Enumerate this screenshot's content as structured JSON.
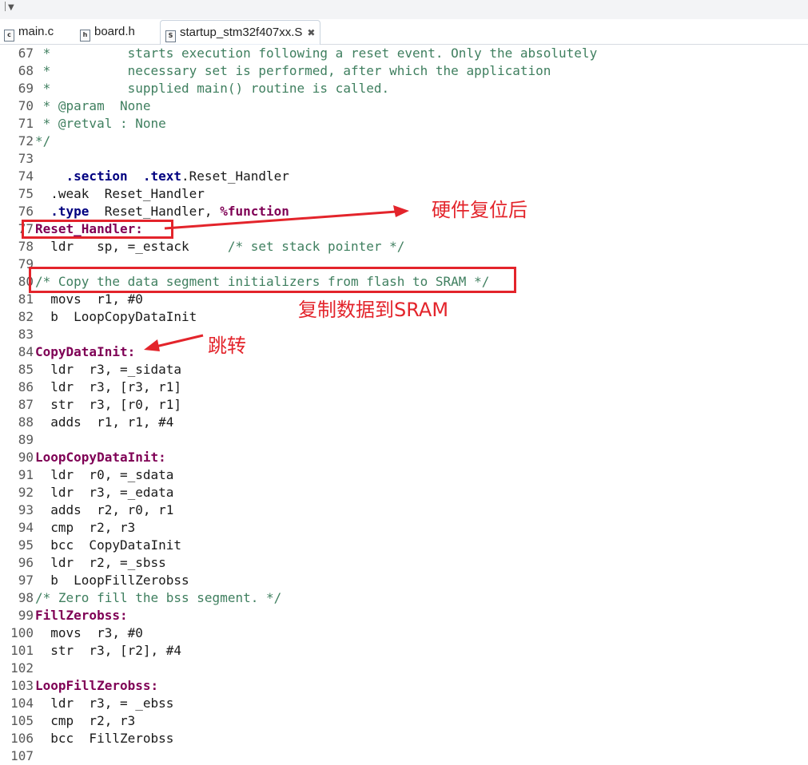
{
  "tabs": [
    {
      "label": "main.c",
      "icon": "c-file-icon",
      "icon_glyph": "c",
      "active": false
    },
    {
      "label": "board.h",
      "icon": "h-file-icon",
      "icon_glyph": "h",
      "active": false
    },
    {
      "label": "startup_stm32f407xx.S",
      "icon": "s-file-icon",
      "icon_glyph": "S",
      "active": true,
      "close_glyph": "✖"
    }
  ],
  "code_lines": [
    {
      "n": "67",
      "segs": [
        {
          "t": " *          starts execution following a reset event. Only the absolutely",
          "c": "comment"
        }
      ]
    },
    {
      "n": "68",
      "segs": [
        {
          "t": " *          necessary set is performed, after which the application",
          "c": "comment"
        }
      ]
    },
    {
      "n": "69",
      "segs": [
        {
          "t": " *          supplied main() routine is called.",
          "c": "comment"
        }
      ]
    },
    {
      "n": "70",
      "segs": [
        {
          "t": " * @param  None",
          "c": "comment"
        }
      ]
    },
    {
      "n": "71",
      "segs": [
        {
          "t": " * @retval : None",
          "c": "comment"
        }
      ]
    },
    {
      "n": "72",
      "segs": [
        {
          "t": "*/",
          "c": "comment"
        }
      ]
    },
    {
      "n": "73",
      "segs": []
    },
    {
      "n": "74",
      "segs": [
        {
          "t": "    ",
          "c": ""
        },
        {
          "t": ".section",
          "c": "directive"
        },
        {
          "t": "  ",
          "c": ""
        },
        {
          "t": ".text",
          "c": "directive"
        },
        {
          "t": ".Reset_Handler",
          "c": ""
        }
      ]
    },
    {
      "n": "75",
      "segs": [
        {
          "t": "  .weak  Reset_Handler",
          "c": ""
        }
      ]
    },
    {
      "n": "76",
      "segs": [
        {
          "t": "  ",
          "c": ""
        },
        {
          "t": ".type",
          "c": "directive"
        },
        {
          "t": "  Reset_Handler, ",
          "c": ""
        },
        {
          "t": "%function",
          "c": "kw"
        }
      ]
    },
    {
      "n": "77",
      "segs": [
        {
          "t": "Reset_Handler:",
          "c": "label"
        }
      ]
    },
    {
      "n": "78",
      "segs": [
        {
          "t": "  ldr   sp, =_estack     ",
          "c": ""
        },
        {
          "t": "/* set stack pointer */",
          "c": "comment"
        }
      ]
    },
    {
      "n": "79",
      "segs": []
    },
    {
      "n": "80",
      "segs": [
        {
          "t": "/* Copy the data segment initializers from flash to SRAM */",
          "c": "comment"
        }
      ]
    },
    {
      "n": "81",
      "segs": [
        {
          "t": "  movs  r1, #0",
          "c": ""
        }
      ]
    },
    {
      "n": "82",
      "segs": [
        {
          "t": "  b  LoopCopyDataInit",
          "c": ""
        }
      ]
    },
    {
      "n": "83",
      "segs": []
    },
    {
      "n": "84",
      "segs": [
        {
          "t": "CopyDataInit:",
          "c": "label"
        }
      ]
    },
    {
      "n": "85",
      "segs": [
        {
          "t": "  ldr  r3, =_sidata",
          "c": ""
        }
      ]
    },
    {
      "n": "86",
      "segs": [
        {
          "t": "  ldr  r3, [r3, r1]",
          "c": ""
        }
      ]
    },
    {
      "n": "87",
      "segs": [
        {
          "t": "  str  r3, [r0, r1]",
          "c": ""
        }
      ]
    },
    {
      "n": "88",
      "segs": [
        {
          "t": "  adds  r1, r1, #4",
          "c": ""
        }
      ]
    },
    {
      "n": "89",
      "segs": []
    },
    {
      "n": "90",
      "segs": [
        {
          "t": "LoopCopyDataInit:",
          "c": "label"
        }
      ]
    },
    {
      "n": "91",
      "segs": [
        {
          "t": "  ldr  r0, =_sdata",
          "c": ""
        }
      ]
    },
    {
      "n": "92",
      "segs": [
        {
          "t": "  ldr  r3, =_edata",
          "c": ""
        }
      ]
    },
    {
      "n": "93",
      "segs": [
        {
          "t": "  adds  r2, r0, r1",
          "c": ""
        }
      ]
    },
    {
      "n": "94",
      "segs": [
        {
          "t": "  cmp  r2, r3",
          "c": ""
        }
      ]
    },
    {
      "n": "95",
      "segs": [
        {
          "t": "  bcc  CopyDataInit",
          "c": ""
        }
      ]
    },
    {
      "n": "96",
      "segs": [
        {
          "t": "  ldr  r2, =_sbss",
          "c": ""
        }
      ]
    },
    {
      "n": "97",
      "segs": [
        {
          "t": "  b  LoopFillZerobss",
          "c": ""
        }
      ]
    },
    {
      "n": "98",
      "segs": [
        {
          "t": "/* Zero fill the bss segment. */",
          "c": "comment"
        }
      ]
    },
    {
      "n": "99",
      "segs": [
        {
          "t": "FillZerobss:",
          "c": "label"
        }
      ]
    },
    {
      "n": "100",
      "segs": [
        {
          "t": "  movs  r3, #0",
          "c": ""
        }
      ]
    },
    {
      "n": "101",
      "segs": [
        {
          "t": "  str  r3, [r2], #4",
          "c": ""
        }
      ]
    },
    {
      "n": "102",
      "segs": []
    },
    {
      "n": "103",
      "segs": [
        {
          "t": "LoopFillZerobss:",
          "c": "label"
        }
      ]
    },
    {
      "n": "104",
      "segs": [
        {
          "t": "  ldr  r3, = _ebss",
          "c": ""
        }
      ]
    },
    {
      "n": "105",
      "segs": [
        {
          "t": "  cmp  r2, r3",
          "c": ""
        }
      ]
    },
    {
      "n": "106",
      "segs": [
        {
          "t": "  bcc  FillZerobss",
          "c": ""
        }
      ]
    },
    {
      "n": "107",
      "segs": []
    }
  ],
  "annotations": {
    "reset_note": "硬件复位后",
    "copy_note": "复制数据到SRAM",
    "jump_note": "跳转",
    "color": "#e3242b"
  }
}
